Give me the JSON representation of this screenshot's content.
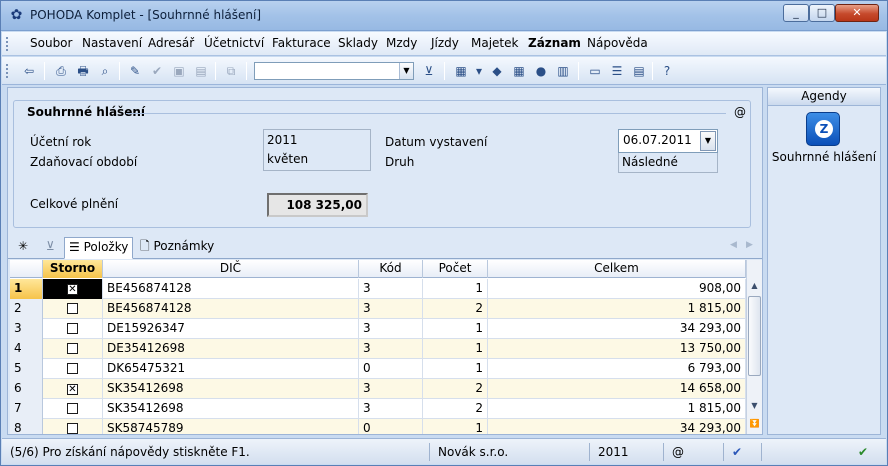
{
  "window": {
    "title": "POHODA Komplet - [Souhrnné hlášení]",
    "controls": {
      "minimize": "_",
      "maximize": "□",
      "close": "✕"
    }
  },
  "menu": [
    "Soubor",
    "Nastavení",
    "Adresář",
    "Účetnictví",
    "Fakturace",
    "Sklady",
    "Mzdy",
    "Jízdy",
    "Majetek",
    "Záznam",
    "Nápověda"
  ],
  "toolbar": {
    "combo_value": ""
  },
  "form": {
    "section_title": "Souhrnné hlášení",
    "at_symbol": "@",
    "ucetni_rok_label": "Účetní rok",
    "ucetni_rok_value": "2011",
    "zdanovaci_obdobi_label": "Zdaňovací období",
    "zdanovaci_obdobi_value": "květen",
    "datum_vystaveni_label": "Datum vystavení",
    "datum_vystaveni_value": "06.07.2011",
    "druh_label": "Druh",
    "druh_value": "Následné",
    "celkove_plneni_label": "Celkové plnění",
    "celkove_plneni_value": "108 325,00"
  },
  "tabs": {
    "star": "✳",
    "filter": "⊻",
    "polozky": "Položky",
    "poznamky": "Poznámky"
  },
  "grid": {
    "columns": [
      "",
      "Storno",
      "DIČ",
      "Kód",
      "Počet",
      "Celkem"
    ],
    "rows": [
      {
        "n": "1",
        "storno": true,
        "dic": "BE456874128",
        "kod": "3",
        "pocet": "1",
        "celkem": "908,00"
      },
      {
        "n": "2",
        "storno": false,
        "dic": "BE456874128",
        "kod": "3",
        "pocet": "2",
        "celkem": "1 815,00"
      },
      {
        "n": "3",
        "storno": false,
        "dic": "DE15926347",
        "kod": "3",
        "pocet": "1",
        "celkem": "34 293,00"
      },
      {
        "n": "4",
        "storno": false,
        "dic": "DE35412698",
        "kod": "3",
        "pocet": "1",
        "celkem": "13 750,00"
      },
      {
        "n": "5",
        "storno": false,
        "dic": "DK65475321",
        "kod": "0",
        "pocet": "1",
        "celkem": "6 793,00"
      },
      {
        "n": "6",
        "storno": true,
        "dic": "SK35412698",
        "kod": "3",
        "pocet": "2",
        "celkem": "14 658,00"
      },
      {
        "n": "7",
        "storno": false,
        "dic": "SK35412698",
        "kod": "3",
        "pocet": "2",
        "celkem": "1 815,00"
      },
      {
        "n": "8",
        "storno": false,
        "dic": "SK58745789",
        "kod": "0",
        "pocet": "1",
        "celkem": "34 293,00"
      }
    ]
  },
  "agenda": {
    "header": "Agendy",
    "item_label": "Souhrnné hlášení"
  },
  "status": {
    "help": "(5/6) Pro získání nápovědy stiskněte F1.",
    "company": "Novák  s.r.o.",
    "year": "2011",
    "at": "@"
  }
}
